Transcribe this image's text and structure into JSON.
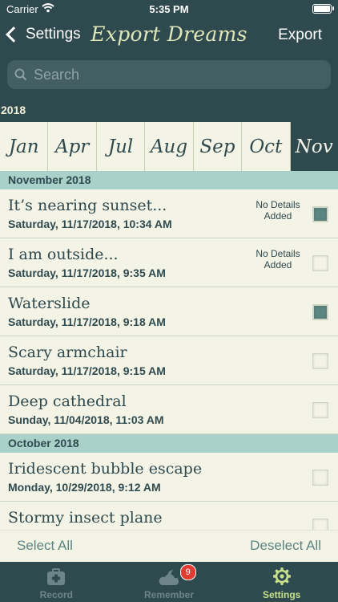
{
  "status_bar": {
    "carrier": "Carrier",
    "time": "5:35 PM"
  },
  "nav": {
    "back_label": "Settings",
    "title": "Export Dreams",
    "action_label": "Export"
  },
  "search": {
    "placeholder": "Search"
  },
  "year": "2018",
  "months": [
    "Jan",
    "Apr",
    "Jul",
    "Aug",
    "Sep",
    "Oct",
    "Nov"
  ],
  "selected_month": "Nov",
  "sections": [
    {
      "header": "November 2018",
      "rows": [
        {
          "title": "It’s nearing sunset...",
          "date": "Saturday, 11/17/2018, 10:34 AM",
          "note": "No Details Added",
          "checked": true
        },
        {
          "title": "I am outside...",
          "date": "Saturday, 11/17/2018, 9:35 AM",
          "note": "No Details Added",
          "checked": false
        },
        {
          "title": "Waterslide",
          "date": "Saturday, 11/17/2018, 9:18 AM",
          "note": "",
          "checked": true
        },
        {
          "title": "Scary armchair",
          "date": "Saturday, 11/17/2018, 9:15 AM",
          "note": "",
          "checked": false
        },
        {
          "title": "Deep cathedral",
          "date": "Sunday, 11/04/2018, 11:03 AM",
          "note": "",
          "checked": false
        }
      ]
    },
    {
      "header": "October 2018",
      "rows": [
        {
          "title": "Iridescent bubble escape",
          "date": "Monday, 10/29/2018, 9:12 AM",
          "note": "",
          "checked": false
        },
        {
          "title": "Stormy insect plane",
          "date": "",
          "note": "",
          "checked": false
        }
      ]
    }
  ],
  "select_bar": {
    "select_all": "Select All",
    "deselect_all": "Deselect All"
  },
  "tabs": [
    {
      "label": "Record",
      "icon": "medkit-icon",
      "active": false
    },
    {
      "label": "Remember",
      "icon": "cloud-moon-icon",
      "active": false,
      "badge": "9"
    },
    {
      "label": "Settings",
      "icon": "gear-icon",
      "active": true
    }
  ],
  "colors": {
    "primary": "#2f4a4f",
    "background": "#f4f4e6",
    "section": "#a9d0c9",
    "accent": "#c7e08a",
    "title": "#dfe7b8",
    "badge": "#e23b31",
    "checked": "#5b8581"
  }
}
